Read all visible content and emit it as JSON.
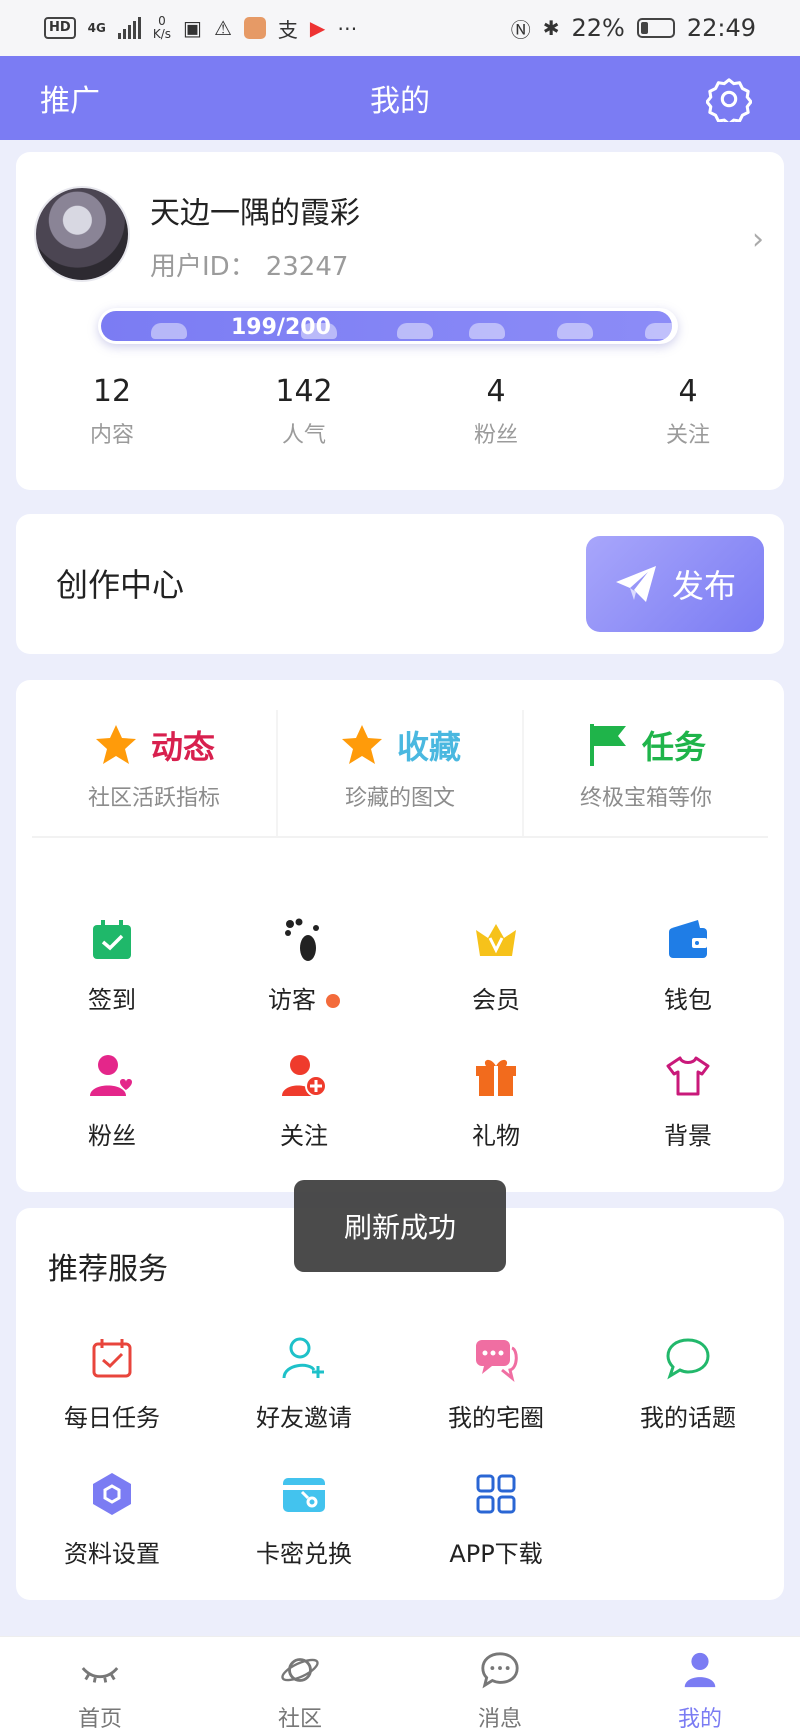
{
  "status_bar": {
    "hd": "HD",
    "net": "4G",
    "speed_value": "0",
    "speed_unit": "K/s",
    "battery": "22%",
    "time": "22:49"
  },
  "header": {
    "left": "推广",
    "title": "我的"
  },
  "profile": {
    "name": "天边一隅的霞彩",
    "id_label": "用户ID：",
    "id_value": "23247",
    "xp_text": "199/200",
    "xp_fraction": 0.995,
    "stats": [
      {
        "num": "12",
        "label": "内容"
      },
      {
        "num": "142",
        "label": "人气"
      },
      {
        "num": "4",
        "label": "粉丝"
      },
      {
        "num": "4",
        "label": "关注"
      }
    ]
  },
  "creation": {
    "label": "创作中心",
    "publish": "发布"
  },
  "features": [
    {
      "title": "动态",
      "subtitle": "社区活跃指标",
      "color": "#d8204e",
      "icon": "star-icon"
    },
    {
      "title": "收藏",
      "subtitle": "珍藏的图文",
      "color": "#4ab8e0",
      "icon": "star-icon"
    },
    {
      "title": "任务",
      "subtitle": "终极宝箱等你",
      "color": "#1fb44a",
      "icon": "flag-icon"
    }
  ],
  "grid": [
    {
      "label": "签到",
      "icon": "calendar-check-icon"
    },
    {
      "label": "访客",
      "icon": "footprint-icon",
      "dot": true
    },
    {
      "label": "会员",
      "icon": "crown-icon"
    },
    {
      "label": "钱包",
      "icon": "wallet-icon"
    },
    {
      "label": "粉丝",
      "icon": "fan-user-icon"
    },
    {
      "label": "关注",
      "icon": "follow-user-icon"
    },
    {
      "label": "礼物",
      "icon": "gift-icon"
    },
    {
      "label": "背景",
      "icon": "shirt-icon"
    }
  ],
  "recommend": {
    "title": "推荐服务",
    "items": [
      {
        "label": "每日任务",
        "icon": "daily-task-icon"
      },
      {
        "label": "好友邀请",
        "icon": "invite-user-icon"
      },
      {
        "label": "我的宅圈",
        "icon": "chat-bubbles-icon"
      },
      {
        "label": "我的话题",
        "icon": "topic-bubble-icon"
      },
      {
        "label": "资料设置",
        "icon": "hexagon-settings-icon"
      },
      {
        "label": "卡密兑换",
        "icon": "card-redeem-icon"
      },
      {
        "label": "APP下载",
        "icon": "app-grid-icon"
      }
    ]
  },
  "toast": "刷新成功",
  "tabs": [
    {
      "label": "首页",
      "icon": "eye-closed-icon"
    },
    {
      "label": "社区",
      "icon": "planet-icon"
    },
    {
      "label": "消息",
      "icon": "message-icon"
    },
    {
      "label": "我的",
      "icon": "person-icon",
      "active": true
    }
  ],
  "colors": {
    "accent": "#7b7cf3",
    "background": "#eceefb"
  }
}
